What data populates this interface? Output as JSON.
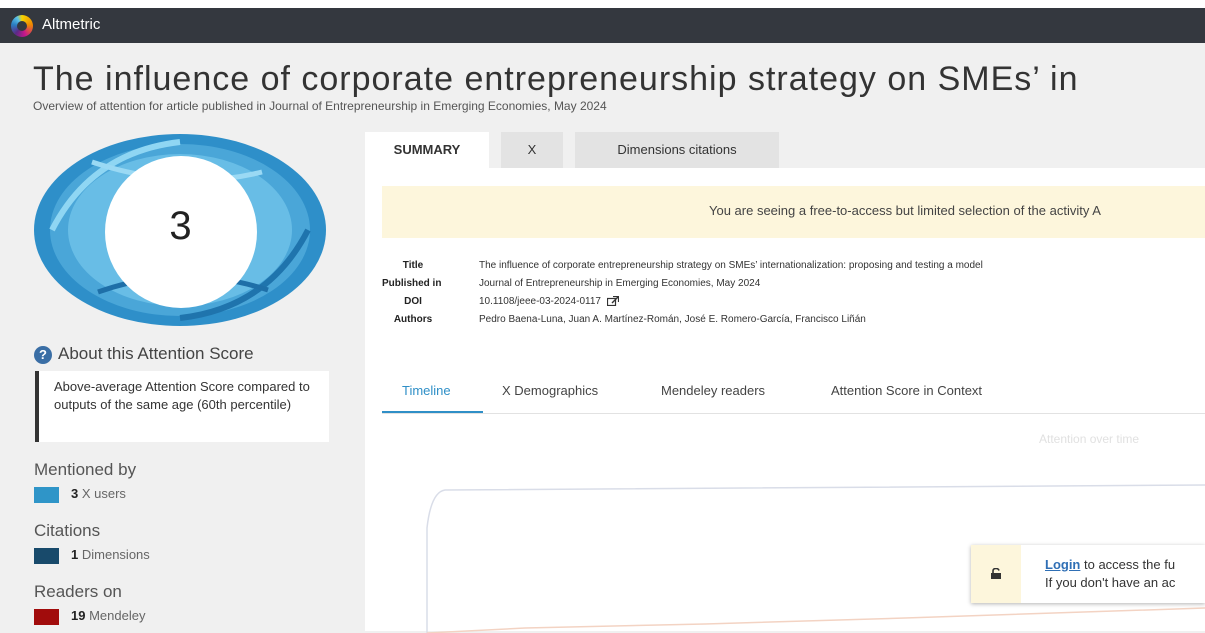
{
  "app": {
    "name": "Altmetric"
  },
  "header": {
    "title": "The influence of corporate entrepreneurship strategy on SMEs’ in",
    "subtitle": "Overview of attention for article published in Journal of Entrepreneurship in Emerging Economies, May 2024"
  },
  "score": {
    "value": "3"
  },
  "about": {
    "heading": "About this Attention Score",
    "text": "Above-average Attention Score compared to outputs of the same age (60th percentile)"
  },
  "mentioned_by": {
    "heading": "Mentioned by",
    "items": [
      {
        "count": "3",
        "label": "X users",
        "color": "#2f95c8"
      }
    ]
  },
  "citations": {
    "heading": "Citations",
    "items": [
      {
        "count": "1",
        "label": "Dimensions",
        "color": "#184a6b"
      }
    ]
  },
  "readers": {
    "heading": "Readers on",
    "items": [
      {
        "count": "19",
        "label": "Mendeley",
        "color": "#a10c0c"
      }
    ]
  },
  "tabs": [
    "SUMMARY",
    "X",
    "Dimensions citations"
  ],
  "notice": "You are seeing a free-to-access but limited selection of the activity A",
  "meta": {
    "title_label": "Title",
    "title_value": "The influence of corporate entrepreneurship strategy on SMEs’ internationalization: proposing and testing a model",
    "published_label": "Published in",
    "published_value": "Journal of Entrepreneurship in Emerging Economies, May 2024",
    "doi_label": "DOI",
    "doi_value": "10.1108/jeee-03-2024-0117",
    "authors_label": "Authors",
    "authors_value": "Pedro Baena-Luna, Juan A. Martínez-Román, José E. Romero-García, Francisco Liñán"
  },
  "subtabs": [
    "Timeline",
    "X Demographics",
    "Mendeley readers",
    "Attention Score in Context"
  ],
  "chart": {
    "title": "Attention over time"
  },
  "login": {
    "link": "Login",
    "line1_rest": " to access the fu",
    "line2": "If you don't have an ac"
  },
  "colors": {
    "accent": "#2f8fc7",
    "topbar": "#34383f",
    "notice_bg": "#fdf6dc"
  },
  "icons": {
    "about": "question-circle-icon",
    "doi": "external-link-icon",
    "lock": "lock-icon"
  }
}
